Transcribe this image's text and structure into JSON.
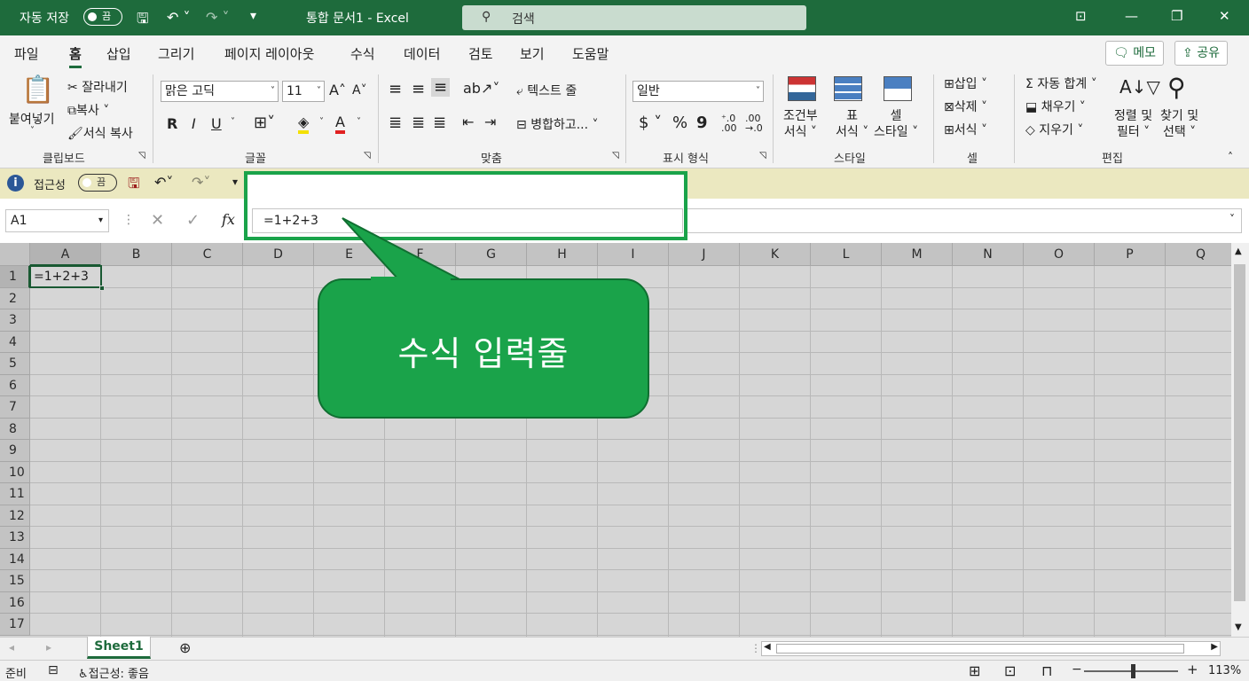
{
  "titlebar": {
    "autosave_label": "자동 저장",
    "autosave_state": "끔",
    "doc_title": "통합 문서1 - Excel",
    "search_placeholder": "검색"
  },
  "tabs": [
    "파일",
    "홈",
    "삽입",
    "그리기",
    "페이지 레이아웃",
    "수식",
    "데이터",
    "검토",
    "보기",
    "도움말"
  ],
  "active_tab": "홈",
  "tab_actions": {
    "memo": "메모",
    "share": "공유"
  },
  "ribbon": {
    "clipboard": {
      "paste": "붙여넣기",
      "cut": "잘라내기",
      "copy": "복사",
      "format_painter": "서식 복사",
      "group": "클립보드"
    },
    "font": {
      "name": "맑은 고딕",
      "size": "11",
      "bold": "R",
      "italic": "I",
      "underline": "U",
      "group": "글꼴"
    },
    "alignment": {
      "wrap": "텍스트 줄",
      "merge": "병합하고...",
      "group": "맞춤"
    },
    "number": {
      "format": "일반",
      "currency": "$",
      "percent": "%",
      "comma": "9",
      "group": "표시 형식"
    },
    "styles": {
      "conditional": [
        "조건부",
        "서식"
      ],
      "table": [
        "표",
        "서식"
      ],
      "cell": [
        "셀",
        "스타일"
      ],
      "group": "스타일"
    },
    "cells": {
      "insert": "삽입",
      "delete": "삭제",
      "format": "서식",
      "group": "셀"
    },
    "editing": {
      "autosum": "자동 합계",
      "fill": "채우기",
      "clear": "지우기",
      "sort": [
        "정렬 및",
        "필터"
      ],
      "find": [
        "찾기 및",
        "선택"
      ],
      "group": "편집"
    }
  },
  "qbar": {
    "info": "접근성",
    "toggle": "끔"
  },
  "formula_bar": {
    "name_box": "A1",
    "fx": "fx",
    "value": "=1+2+3"
  },
  "columns": [
    "A",
    "B",
    "C",
    "D",
    "E",
    "F",
    "G",
    "H",
    "I",
    "J",
    "K",
    "L",
    "M",
    "N",
    "O",
    "P",
    "Q"
  ],
  "rows": [
    "1",
    "2",
    "3",
    "4",
    "5",
    "6",
    "7",
    "8",
    "9",
    "10",
    "11",
    "12",
    "13",
    "14",
    "15",
    "16",
    "17"
  ],
  "cell_a1": "=1+2+3",
  "callout": "수식 입력줄",
  "sheet_tab": "Sheet1",
  "status": {
    "ready": "준비",
    "accessibility": "접근성: 좋음",
    "zoom": "113%"
  },
  "colors": {
    "excel_green": "#1e6b3c",
    "callout_green": "#1aa34a"
  }
}
